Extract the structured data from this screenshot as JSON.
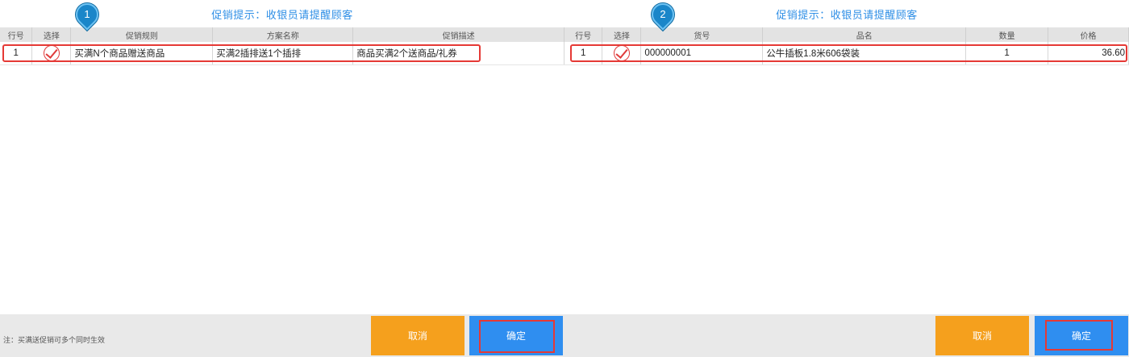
{
  "left": {
    "title": "促销提示：收银员请提醒顾客",
    "marker": "1",
    "columns": [
      "行号",
      "选择",
      "促销规则",
      "方案名称",
      "促销描述"
    ],
    "row": {
      "line_no": "1",
      "rule": "买满N个商品赠送商品",
      "plan_name": "买满2插排送1个插排",
      "description": "商品买满2个送商品/礼券"
    }
  },
  "right": {
    "title": "促销提示：收银员请提醒顾客",
    "marker": "2",
    "columns": [
      "行号",
      "选择",
      "货号",
      "品名",
      "数量",
      "价格"
    ],
    "row": {
      "line_no": "1",
      "sku": "000000001",
      "product_name": "公牛插板1.8米606袋装",
      "quantity": "1",
      "price": "36.60"
    }
  },
  "footer": {
    "note": "注：买满送促销可多个同时生效",
    "left_cancel": "取消",
    "left_ok": "确定",
    "right_cancel": "取消",
    "right_ok": "确定"
  },
  "colors": {
    "accent_blue": "#2f8fe6",
    "cancel_orange": "#f5a01d",
    "ok_blue": "#2f8ef0",
    "highlight_red": "#e53935"
  }
}
